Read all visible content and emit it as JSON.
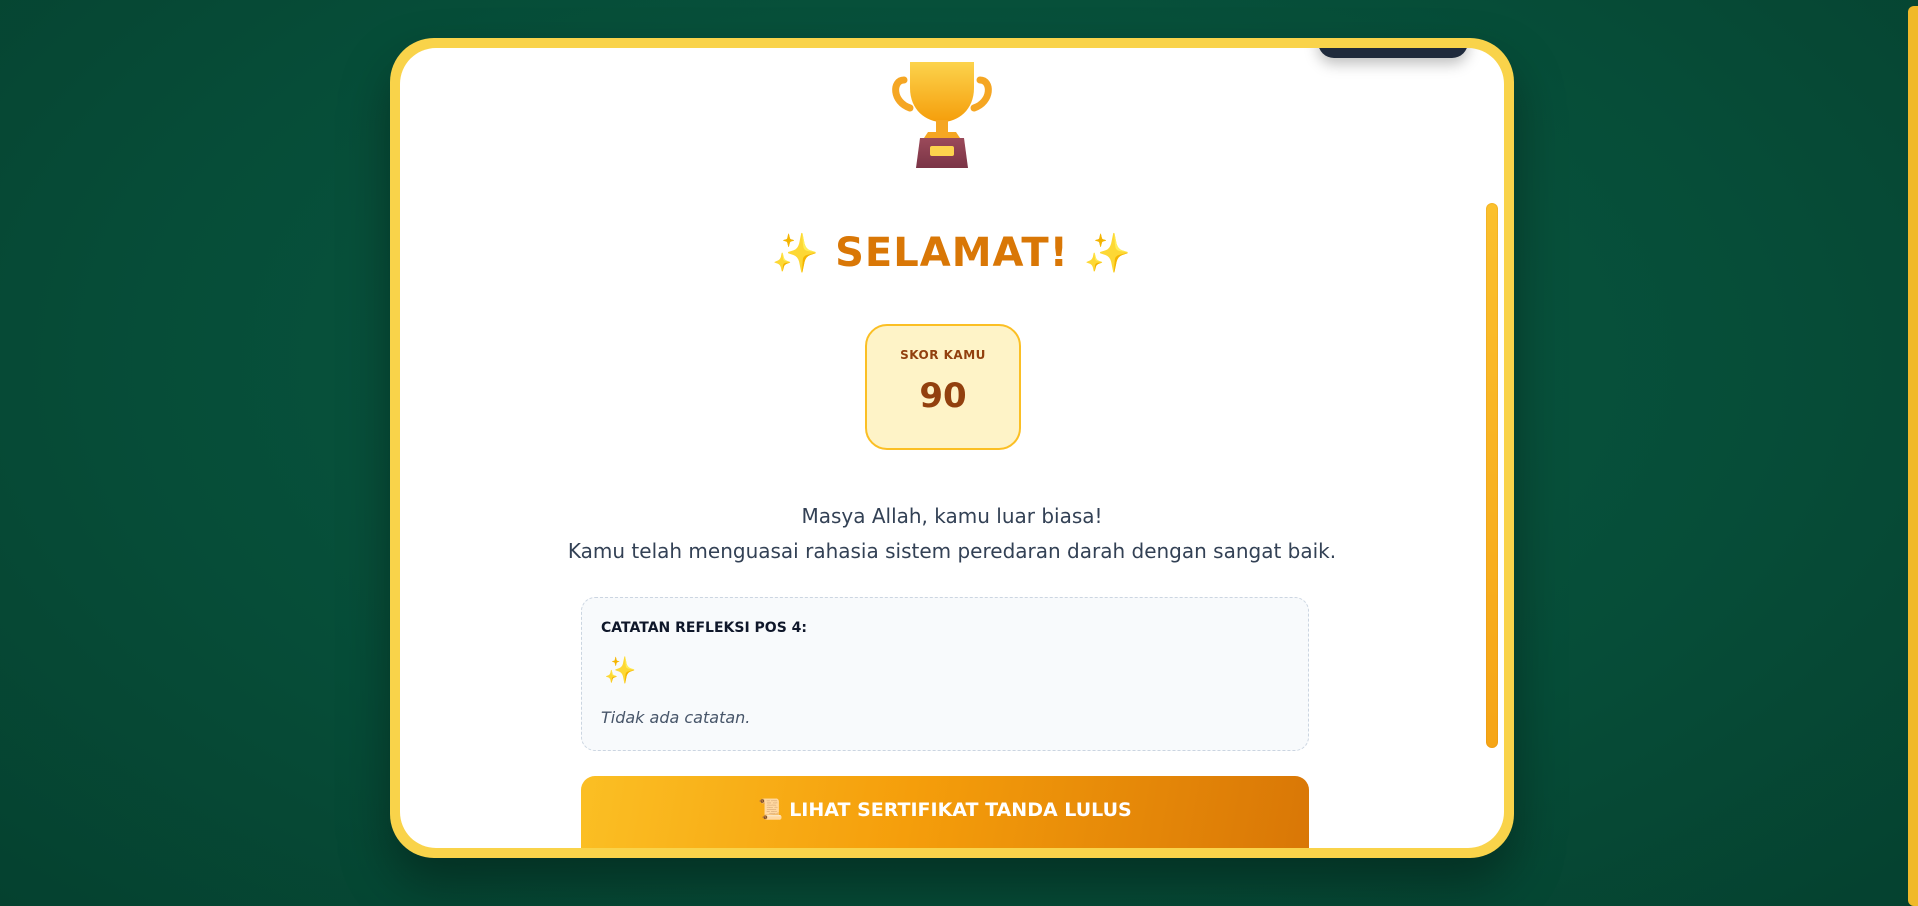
{
  "result": {
    "title": "SELAMAT!",
    "title_sparkle_left": "✨",
    "title_sparkle_right": "✨",
    "score_label": "SKOR KAMU",
    "score_value": "90",
    "message_line1": "Masya Allah, kamu luar biasa!",
    "message_line2": "Kamu telah menguasai rahasia sistem peredaran darah dengan sangat baik."
  },
  "reflection": {
    "title": "CATATAN REFLEKSI POS 4:",
    "sparkle": "✨",
    "note": "Tidak ada catatan."
  },
  "certificate_button": {
    "icon": "📜",
    "label": "LIHAT SERTIFIKAT TANDA LULUS"
  },
  "icons": {
    "trophy": "trophy-icon",
    "sparkle": "sparkle-icon",
    "scroll": "scroll-icon"
  },
  "colors": {
    "background": "#064d38",
    "frame": "#f9d34a",
    "title": "#d97706",
    "score_box_bg": "#fef3c7",
    "score_text": "#92400e",
    "button_start": "#fbbf24",
    "button_end": "#d97706"
  }
}
